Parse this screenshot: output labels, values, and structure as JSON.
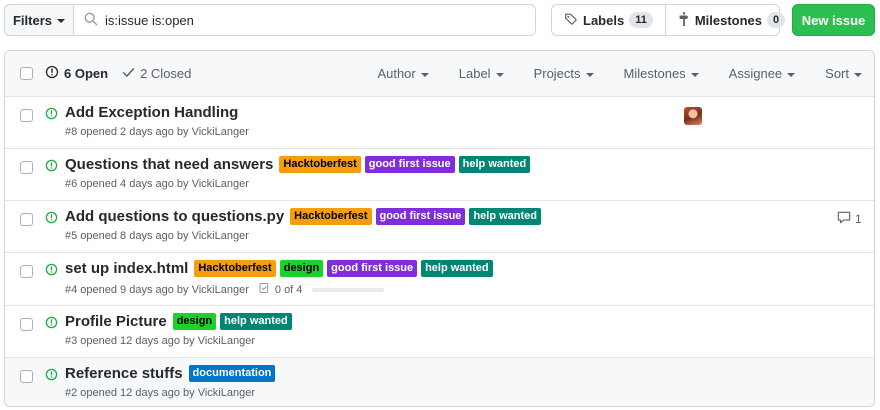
{
  "toolbar": {
    "filters_label": "Filters",
    "search_value": "is:issue is:open",
    "labels_label": "Labels",
    "labels_count": "11",
    "milestones_label": "Milestones",
    "milestones_count": "0",
    "new_issue_label": "New issue",
    "new_issue_color": "#2cbe4e"
  },
  "header": {
    "open_label": "6 Open",
    "closed_label": "2 Closed",
    "filters": [
      "Author",
      "Label",
      "Projects",
      "Milestones",
      "Assignee",
      "Sort"
    ]
  },
  "label_colors": {
    "Hacktoberfest": {
      "bg": "#f59d0c",
      "fg": "#000000"
    },
    "good first issue": {
      "bg": "#7e2fdb",
      "fg": "#ffffff"
    },
    "help wanted": {
      "bg": "#008672",
      "fg": "#ffffff"
    },
    "design": {
      "bg": "#1bd12b",
      "fg": "#000000"
    },
    "documentation": {
      "bg": "#0075ca",
      "fg": "#ffffff"
    }
  },
  "issues": [
    {
      "title": "Add Exception Handling",
      "meta": "#8 opened 2 days ago by VickiLanger",
      "labels": [],
      "avatar": "avatar-icon"
    },
    {
      "title": "Questions that need answers",
      "meta": "#6 opened 4 days ago by VickiLanger",
      "labels": [
        "Hacktoberfest",
        "good first issue",
        "help wanted"
      ]
    },
    {
      "title": "Add questions to questions.py",
      "meta": "#5 opened 8 days ago by VickiLanger",
      "labels": [
        "Hacktoberfest",
        "good first issue",
        "help wanted"
      ],
      "comments": "1"
    },
    {
      "title": "set up index.html",
      "meta": "#4 opened 9 days ago by VickiLanger",
      "labels": [
        "Hacktoberfest",
        "design",
        "good first issue",
        "help wanted"
      ],
      "tasks": "0 of 4",
      "tasks_progress": 0
    },
    {
      "title": "Profile Picture",
      "meta": "#3 opened 12 days ago by VickiLanger",
      "labels": [
        "design",
        "help wanted"
      ]
    },
    {
      "title": "Reference stuffs",
      "meta": "#2 opened 12 days ago by VickiLanger",
      "labels": [
        "documentation"
      ],
      "hover": true
    }
  ]
}
